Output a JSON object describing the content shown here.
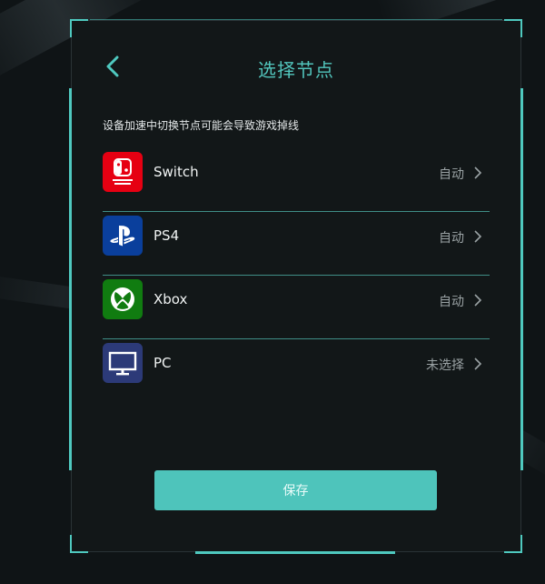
{
  "dialog": {
    "title": "选择节点",
    "warning": "设备加速中切换节点可能会导致游戏掉线",
    "save_label": "保存"
  },
  "items": [
    {
      "name": "Switch",
      "value": "自动",
      "icon": "nintendo-switch-icon",
      "color": "#e60012"
    },
    {
      "name": "PS4",
      "value": "自动",
      "icon": "playstation-icon",
      "color": "#0a3f9c"
    },
    {
      "name": "Xbox",
      "value": "自动",
      "icon": "xbox-icon",
      "color": "#107c10"
    },
    {
      "name": "PC",
      "value": "未选择",
      "icon": "monitor-icon",
      "color": "#2c3a78"
    }
  ],
  "colors": {
    "accent": "#4fc9bf",
    "background": "#121718"
  }
}
